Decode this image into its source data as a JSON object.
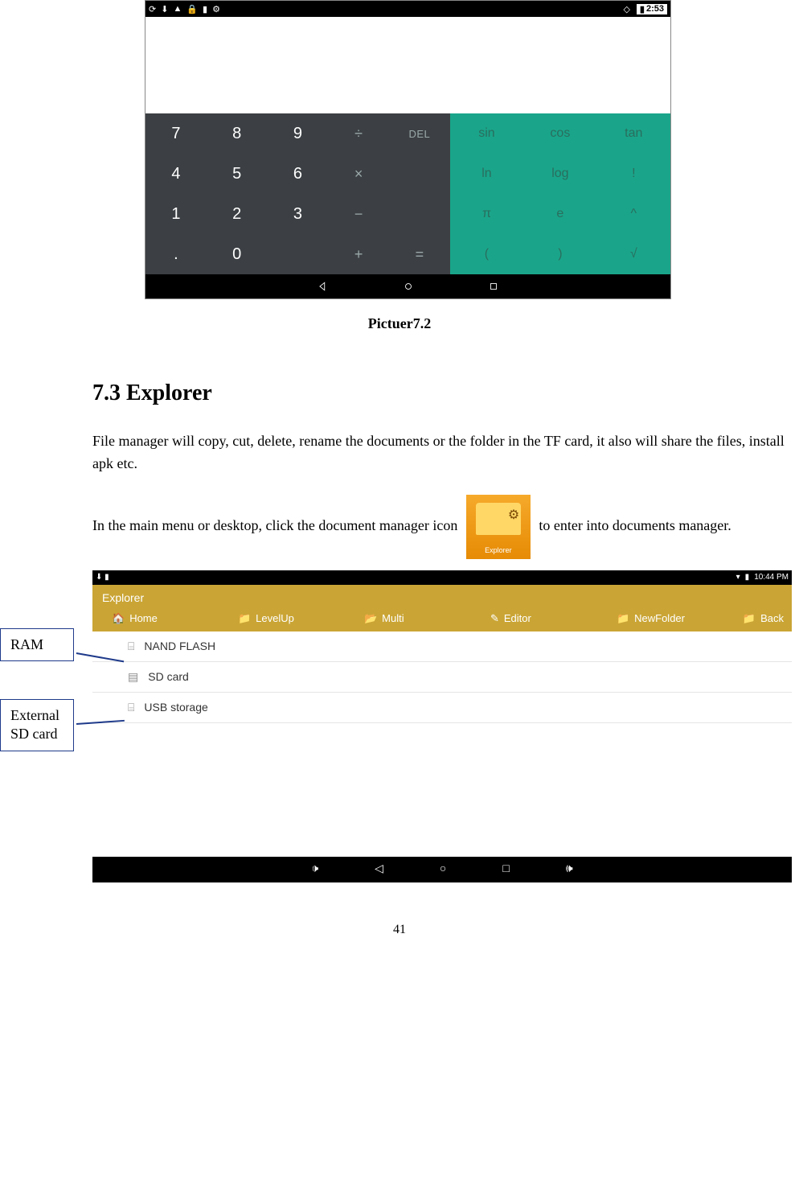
{
  "calculator": {
    "status_time": "2:53",
    "keys_dark": [
      "7",
      "8",
      "9",
      "÷",
      "DEL",
      "4",
      "5",
      "6",
      "×",
      "",
      "1",
      "2",
      "3",
      "−",
      "",
      ".",
      "0",
      "",
      "+",
      "="
    ],
    "keys_teal": [
      "sin",
      "cos",
      "tan",
      "ln",
      "log",
      "!",
      "π",
      "e",
      "^",
      "(",
      ")",
      "√"
    ]
  },
  "caption1": "Pictuer7.2",
  "section_heading": "7.3 Explorer",
  "para1": "File manager will copy, cut, delete, rename the documents or the folder in the TF card, it also will share the files, install apk etc.",
  "para2_pre": "In the main menu or desktop, click the document manager icon ",
  "para2_post": " to enter into documents manager.",
  "app_icon_label": "Explorer",
  "explorer": {
    "status_time": "10:44 PM",
    "title": "Explorer",
    "toolbar": [
      "Home",
      "LevelUp",
      "Multi",
      "Editor",
      "NewFolder",
      "Back"
    ],
    "rows": [
      "NAND FLASH",
      "SD card",
      "USB storage"
    ]
  },
  "callouts": {
    "ram": "RAM",
    "sd_line1": "External",
    "sd_line2": "SD card"
  },
  "page_number": "41"
}
